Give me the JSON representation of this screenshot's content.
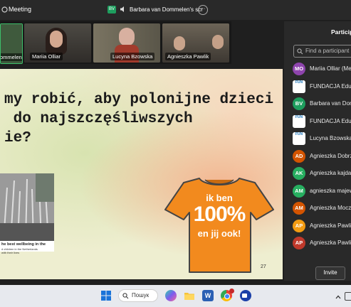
{
  "titlebar": {
    "app_title": "Meeting",
    "speaker_initials": "BV",
    "sharing_label": "Barbara van Dommelen's scr",
    "more": "···"
  },
  "gallery": [
    {
      "name": "ommelen",
      "color": "#3f5a3d"
    },
    {
      "name": "Mariia Olliar",
      "color": "#6b5a4e"
    },
    {
      "name": "Lucyna Bzowska",
      "color": "#7a7260"
    },
    {
      "name": "Agnieszka Pawlik",
      "color": "#5a5249"
    }
  ],
  "slide": {
    "title": "my robić, aby polonijne dzieci\n do najszczęśliwszych\nie?",
    "photo_caption": "he best wellbeing in the",
    "photo_subcaption": "d children in the Netherlands\nwith their lives",
    "shirt_line1": "ik ben",
    "shirt_line2": "100%",
    "shirt_line3": "en jij ook!",
    "page_number": "27",
    "shirt_color": "#f28a1e"
  },
  "participants": {
    "title": "Particip",
    "search_placeholder": "Find a participant",
    "list": [
      {
        "initials": "MO",
        "name": "Mariia Olliar (Me",
        "color": "#8e44ad",
        "logo": false
      },
      {
        "initials": "FUN",
        "name": "FUNDACJA EduS",
        "color": "#ffffff",
        "logo": true
      },
      {
        "initials": "BV",
        "name": "Barbara van Dom",
        "color": "#1e9e5e",
        "logo": false
      },
      {
        "initials": "FUN",
        "name": "FUNDACJA EduS",
        "color": "#ffffff",
        "logo": true
      },
      {
        "initials": "FUN",
        "name": "Lucyna Bzowska",
        "color": "#ffffff",
        "logo": true
      },
      {
        "initials": "AD",
        "name": "Agnieszka Dobrz",
        "color": "#d35400",
        "logo": false
      },
      {
        "initials": "AK",
        "name": "Agnieszka kajda",
        "color": "#27ae60",
        "logo": false
      },
      {
        "initials": "AM",
        "name": "agnieszka majew",
        "color": "#27ae60",
        "logo": false
      },
      {
        "initials": "AM",
        "name": "Agnieszka Moczu",
        "color": "#d35400",
        "logo": false
      },
      {
        "initials": "AP",
        "name": "Agnieszka Pawlik",
        "color": "#f39c12",
        "logo": false
      },
      {
        "initials": "AP",
        "name": "Agnieszka Pawlin",
        "color": "#c0392b",
        "logo": false
      }
    ],
    "invite_label": "Invite"
  },
  "taskbar": {
    "search_label": "Пошук"
  }
}
